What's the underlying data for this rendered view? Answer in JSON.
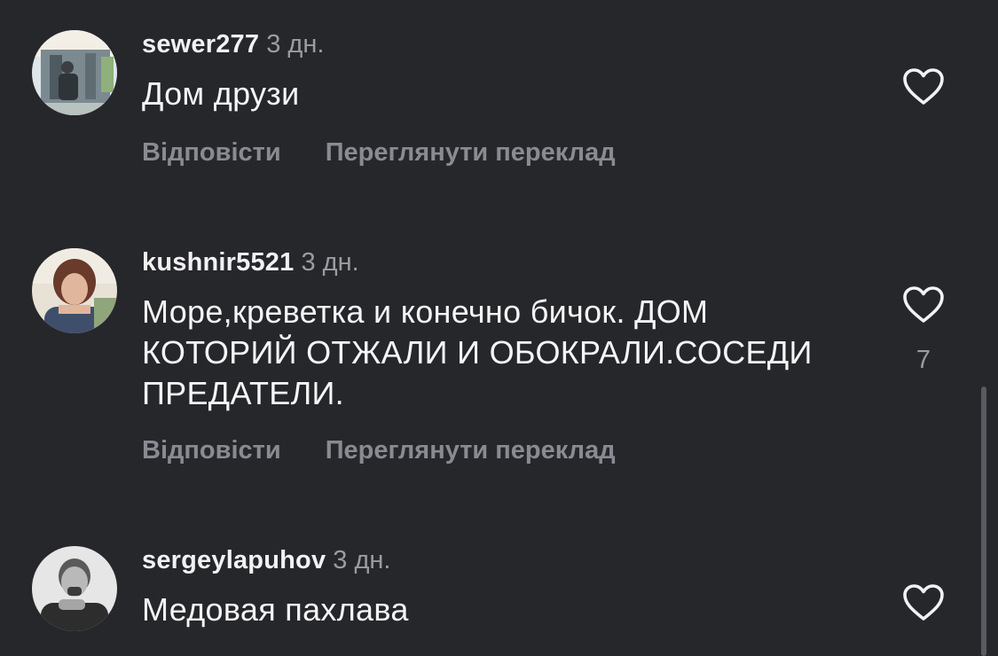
{
  "theme": {
    "background": "#26272b",
    "text_primary": "#f5f5f7",
    "text_secondary": "#9b9ca3",
    "action_color": "#8a8b92",
    "icon_color": "#f2f2f4"
  },
  "comments": [
    {
      "username": "sewer277",
      "time": "3 дн.",
      "text": "Дом друзи",
      "reply_label": "Відповісти",
      "translate_label": "Переглянути переклад",
      "like_icon": "heart-outline-icon",
      "like_count": ""
    },
    {
      "username": "kushnir5521",
      "time": "3 дн.",
      "text": "Море,креветка и конечно бичок. ДОМ КОТОРИЙ ОТЖАЛИ И ОБОКРАЛИ.СОСЕДИ ПРЕДАТЕЛИ.",
      "reply_label": "Відповісти",
      "translate_label": "Переглянути переклад",
      "like_icon": "heart-outline-icon",
      "like_count": "7"
    },
    {
      "username": "sergeylapuhov",
      "time": "3 дн.",
      "text": "Медовая пахлава",
      "like_icon": "heart-outline-icon",
      "like_count": ""
    }
  ]
}
